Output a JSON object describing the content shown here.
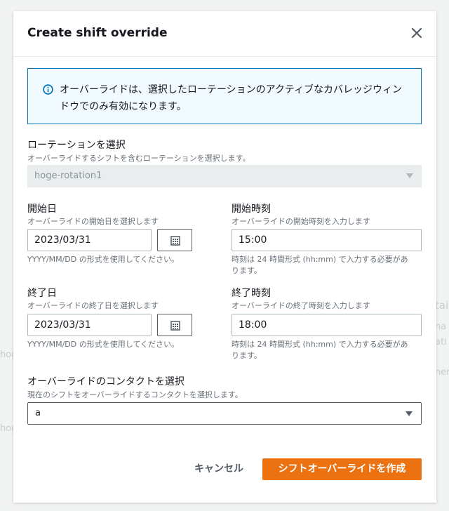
{
  "background": {
    "fragments": [
      "tai",
      "na",
      "ati",
      "hog",
      "ner",
      "hog"
    ]
  },
  "modal": {
    "title": "Create shift override",
    "close_icon": "close-icon",
    "info": {
      "icon": "info-icon",
      "text": "オーバーライドは、選択したローテーションのアクティブなカバレッジウィンドウでのみ有効になります。"
    },
    "rotation": {
      "label": "ローテーションを選択",
      "description": "オーバーライドするシフトを含むローテーションを選択します。",
      "value": "hoge-rotation1"
    },
    "start_date": {
      "label": "開始日",
      "description": "オーバーライドの開始日を選択します",
      "value": "2023/03/31",
      "constraint": "YYYY/MM/DD の形式を使用してください。"
    },
    "start_time": {
      "label": "開始時刻",
      "description": "オーバーライドの開始時刻を入力します",
      "value": "15:00",
      "constraint_line1": "時刻は 24 時間形式 (hh:mm) で入力する必要があ",
      "constraint_line2": "ります。"
    },
    "end_date": {
      "label": "終了日",
      "description": "オーバーライドの終了日を選択します",
      "value": "2023/03/31",
      "constraint": "YYYY/MM/DD の形式を使用してください。"
    },
    "end_time": {
      "label": "終了時刻",
      "description": "オーバーライドの終了時刻を入力します",
      "value": "18:00",
      "constraint_line1": "時刻は 24 時間形式 (hh:mm) で入力する必要があ",
      "constraint_line2": "ります。"
    },
    "contact": {
      "label": "オーバーライドのコンタクトを選択",
      "description": "現在のシフトをオーバーライドするコンタクトを選択します。",
      "value": "a"
    },
    "cancel_label": "キャンセル",
    "submit_label": "シフトオーバーライドを作成"
  },
  "colors": {
    "primary": "#ec7211",
    "info_border": "#0073bb",
    "info_bg": "#f1faff"
  }
}
